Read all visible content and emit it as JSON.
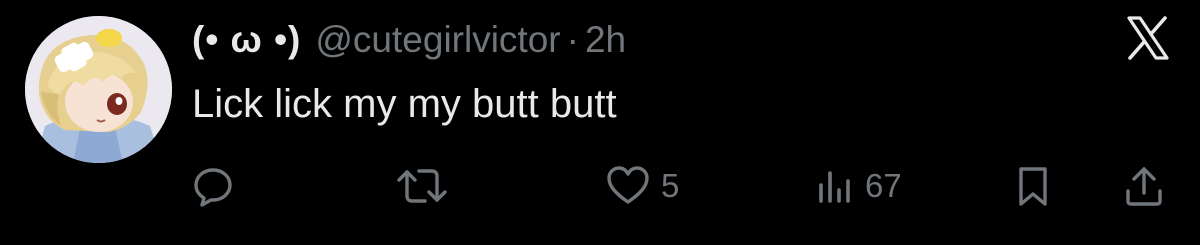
{
  "tweet": {
    "display_name": "(• ω •)",
    "handle": "@cutegirlvictor",
    "separator": "·",
    "time": "2h",
    "text": "Lick lick my my butt butt"
  },
  "actions": {
    "reply_count": "",
    "retweet_count": "",
    "like_count": "5",
    "views_count": "67"
  },
  "icons": [
    "x-logo-icon",
    "reply-icon",
    "retweet-icon",
    "heart-icon",
    "views-icon",
    "bookmark-icon",
    "share-icon"
  ],
  "colors": {
    "background": "#000000",
    "primary_text": "#e7e9ea",
    "secondary_text": "#71767b"
  }
}
